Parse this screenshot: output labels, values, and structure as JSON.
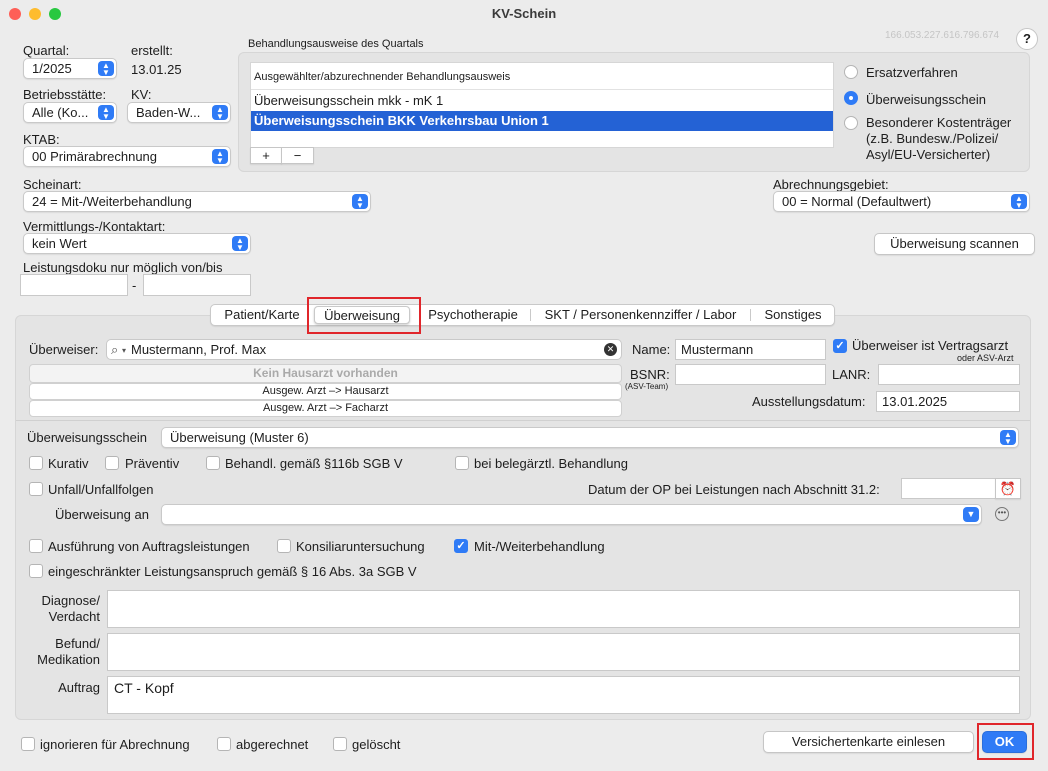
{
  "window": {
    "title": "KV-Schein",
    "id_number": "166.053.227.616.796.674",
    "help": "?"
  },
  "quartal": {
    "label": "Quartal:",
    "value": "1/2025"
  },
  "erstellt": {
    "label": "erstellt:",
    "value": "13.01.25"
  },
  "betriebsstaette": {
    "label": "Betriebsstätte:",
    "value": "Alle (Ko..."
  },
  "kv": {
    "label": "KV:",
    "value": "Baden-W..."
  },
  "ktab": {
    "label": "KTAB:",
    "value": "00 Primärabrechnung"
  },
  "behandlungsausweise": {
    "group_label": "Behandlungsausweise des Quartals",
    "header": "Ausgewählter/abzurechnender Behandlungsausweis",
    "items": [
      "Überweisungsschein mkk - mK 1",
      "Überweisungsschein BKK Verkehrsbau Union 1"
    ],
    "add": "+",
    "remove": "−",
    "radios": [
      "Ersatzverfahren",
      "Überweisungsschein",
      "Besonderer Kostenträger (z.B. Bundesw./Polizei/ Asyl/EU-Versicherter)"
    ]
  },
  "scheinart": {
    "label": "Scheinart:",
    "value": "24 = Mit-/Weiterbehandlung"
  },
  "abrechnungsgebiet": {
    "label": "Abrechnungsgebiet:",
    "value": "00 = Normal (Defaultwert)"
  },
  "vermittlung": {
    "label": "Vermittlungs-/Kontaktart:",
    "value": "kein Wert"
  },
  "ueberweisung_scannen": "Überweisung scannen",
  "leistungsdoku": {
    "label": "Leistungsdoku nur möglich von/bis",
    "dash": "-"
  },
  "tabs": [
    "Patient/Karte",
    "Überweisung",
    "Psychotherapie",
    "SKT / Personenkennziffer / Labor",
    "Sonstiges"
  ],
  "ueberweiser": {
    "label": "Überweiser:",
    "value": "Mustermann, Prof. Max",
    "name_label": "Name:",
    "name_value": "Mustermann",
    "vertragsarzt": "Überweiser ist Vertragsarzt",
    "vertragsarzt_note": "oder ASV-Arzt",
    "kein_hausarzt": "Kein Hausarzt vorhanden",
    "btn_hausarzt": "Ausgew. Arzt –> Hausarzt",
    "btn_facharzt": "Ausgew. Arzt –> Facharzt",
    "bsnr_label": "BSNR:",
    "bsnr_note": "(ASV-Team)",
    "lanr_label": "LANR:",
    "ausstellung_label": "Ausstellungsdatum:",
    "ausstellung_value": "13.01.2025"
  },
  "ueberweisungsschein": {
    "label": "Überweisungsschein",
    "value": "Überweisung (Muster 6)"
  },
  "checks": {
    "kurativ": "Kurativ",
    "praeventiv": "Präventiv",
    "behandl": "Behandl. gemäß §116b SGB V",
    "beleg": "bei belegärztl. Behandlung",
    "unfall": "Unfall/Unfallfolgen",
    "op_label": "Datum der OP bei Leistungen nach Abschnitt 31.2:",
    "ausfuehrung": "Ausführung von Auftragsleistungen",
    "konsiliar": "Konsiliaruntersuchung",
    "mitweiter": "Mit-/Weiterbehandlung",
    "eingeschraenkt": "eingeschränkter Leistungsanspruch gemäß § 16 Abs. 3a SGB V"
  },
  "ueberweisung_an": {
    "label": "Überweisung an",
    "value": ""
  },
  "diagnose": {
    "label1": "Diagnose/",
    "label2": "Verdacht",
    "value": ""
  },
  "befund": {
    "label1": "Befund/",
    "label2": "Medikation",
    "value": ""
  },
  "auftrag": {
    "label": "Auftrag",
    "value": "CT - Kopf"
  },
  "footer": {
    "ignorieren": "ignorieren für Abrechnung",
    "abgerechnet": "abgerechnet",
    "geloescht": "gelöscht",
    "versichertenkarte": "Versichertenkarte einlesen",
    "ok": "OK"
  },
  "colors": {
    "accent": "#2f7bf6",
    "selection": "#2462d5",
    "highlight_box": "#e0262b"
  }
}
